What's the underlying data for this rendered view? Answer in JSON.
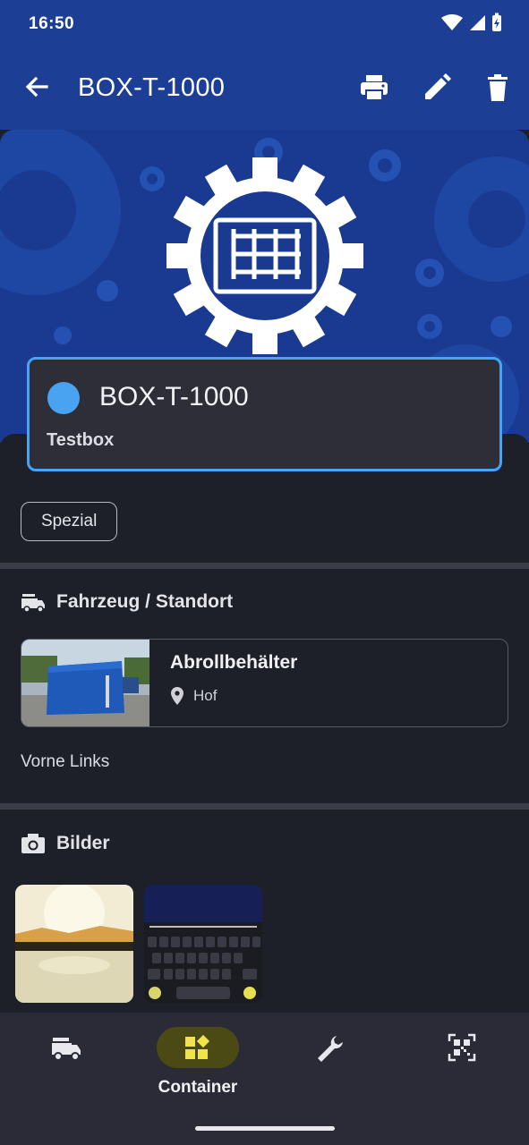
{
  "status_bar": {
    "time": "16:50"
  },
  "app_bar": {
    "title": "BOX-T-1000",
    "actions": [
      "print-icon",
      "edit-icon",
      "delete-icon"
    ]
  },
  "container": {
    "name": "BOX-T-1000",
    "description": "Testbox",
    "status_color": "#4aa3f0",
    "tag": "Spezial"
  },
  "vehicle_section": {
    "title": "Fahrzeug / Standort",
    "vehicle_name": "Abrollbehälter",
    "location": "Hof",
    "position_note": "Vorne Links"
  },
  "images_section": {
    "title": "Bilder",
    "count": 2
  },
  "bottom_nav": {
    "items": [
      {
        "label": "",
        "icon": "fire-truck-icon"
      },
      {
        "label": "Container",
        "icon": "widgets-icon",
        "active": true
      },
      {
        "label": "",
        "icon": "wrench-icon"
      },
      {
        "label": "",
        "icon": "qr-code-scanner-icon"
      }
    ]
  },
  "colors": {
    "accent": "#4aa3f0",
    "app_bar": "#1c3f95",
    "background": "#1e2029",
    "nav_active": "#4c4a14"
  }
}
